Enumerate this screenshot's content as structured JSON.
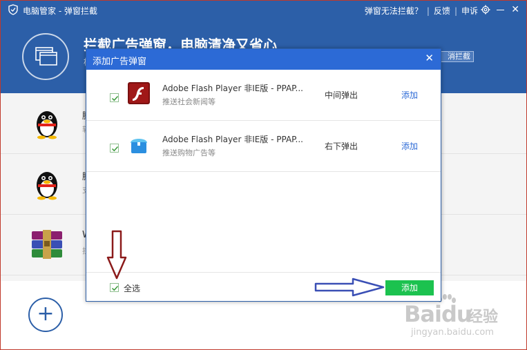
{
  "titlebar": {
    "title": "电脑管家 - 弹窗拦截",
    "links": [
      "弹窗无法拦截？",
      "反馈",
      "申诉"
    ]
  },
  "header": {
    "headline": "拦截广告弹窗，电脑清净又省心",
    "sub": "根",
    "cancel_button": "消拦截"
  },
  "background_list": [
    {
      "t1": "腾",
      "t2": "软"
    },
    {
      "t1": "腾",
      "t2": "支"
    },
    {
      "t1": "W",
      "t2": "拦"
    }
  ],
  "dialog": {
    "title": "添加广告弹窗",
    "rows": [
      {
        "name": "Adobe Flash Player 非IE版 - PPAP...",
        "desc": "推送社会新闻等",
        "position": "中间弹出",
        "action": "添加",
        "checked": true
      },
      {
        "name": "Adobe Flash Player 非IE版 - PPAP...",
        "desc": "推送购物广告等",
        "position": "右下弹出",
        "action": "添加",
        "checked": true
      }
    ],
    "select_all": "全选",
    "add_button": "添加"
  },
  "watermark": {
    "brand": "Bai",
    "brand2": "du",
    "jingyan": "经验",
    "url": "jingyan.baidu.com"
  },
  "colors": {
    "title_blue": "#2c5fa8",
    "dialog_blue": "#2c6ad6",
    "add_green": "#1cc24f"
  }
}
